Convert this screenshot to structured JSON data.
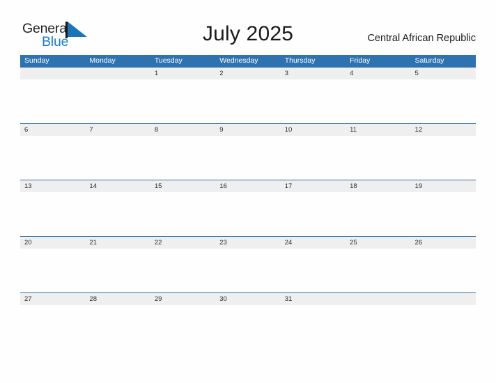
{
  "logo": {
    "text_top": "General",
    "text_bottom": "Blue",
    "flag_icon": "blue-triangle-flag-icon",
    "color_dark": "#222222",
    "color_blue": "#1C7BC4"
  },
  "header": {
    "title": "July 2025",
    "location": "Central African Republic"
  },
  "calendar": {
    "header_bg": "#2E72B0",
    "date_band_bg": "#EFEFEF",
    "grid_line": "#2E72B0",
    "day_names": [
      "Sunday",
      "Monday",
      "Tuesday",
      "Wednesday",
      "Thursday",
      "Friday",
      "Saturday"
    ],
    "weeks": [
      [
        "",
        "",
        "1",
        "2",
        "3",
        "4",
        "5"
      ],
      [
        "6",
        "7",
        "8",
        "9",
        "10",
        "11",
        "12"
      ],
      [
        "13",
        "14",
        "15",
        "16",
        "17",
        "18",
        "19"
      ],
      [
        "20",
        "21",
        "22",
        "23",
        "24",
        "25",
        "26"
      ],
      [
        "27",
        "28",
        "29",
        "30",
        "31",
        "",
        ""
      ]
    ]
  }
}
